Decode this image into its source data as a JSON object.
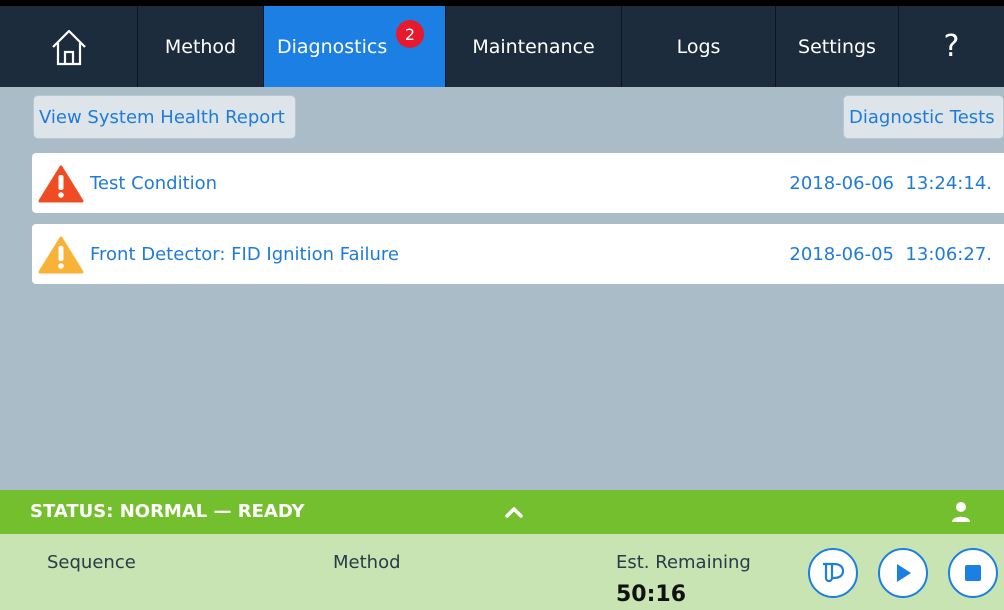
{
  "nav": {
    "items": [
      {
        "label": "Method"
      },
      {
        "label": "Diagnostics",
        "badge": "2"
      },
      {
        "label": "Maintenance"
      },
      {
        "label": "Logs"
      },
      {
        "label": "Settings"
      }
    ],
    "help": "?",
    "active": "Diagnostics"
  },
  "actions": {
    "health_report": "View System Health Report",
    "diagnostic_tests": "Diagnostic Tests"
  },
  "alerts": [
    {
      "severity": "error",
      "icon": "error-triangle-icon",
      "color": "#f04b23",
      "message": "Test Condition",
      "timestamp": "2018-06-06  13:24:14."
    },
    {
      "severity": "warning",
      "icon": "warning-triangle-icon",
      "color": "#f7b237",
      "message": "Front Detector: FID Ignition Failure",
      "timestamp": "2018-06-05  13:06:27."
    }
  ],
  "status": {
    "text": "STATUS: NORMAL — READY",
    "color": "#74bf2d"
  },
  "run": {
    "sequence_label": "Sequence",
    "method_label": "Method",
    "est_remaining_label": "Est. Remaining",
    "est_remaining_value": "50:16"
  },
  "colors": {
    "nav_bg": "#1c2c3c",
    "nav_active": "#1b7fe3",
    "badge": "#e8192c",
    "page_bg": "#a9bcc8",
    "link": "#1f7bd8"
  }
}
